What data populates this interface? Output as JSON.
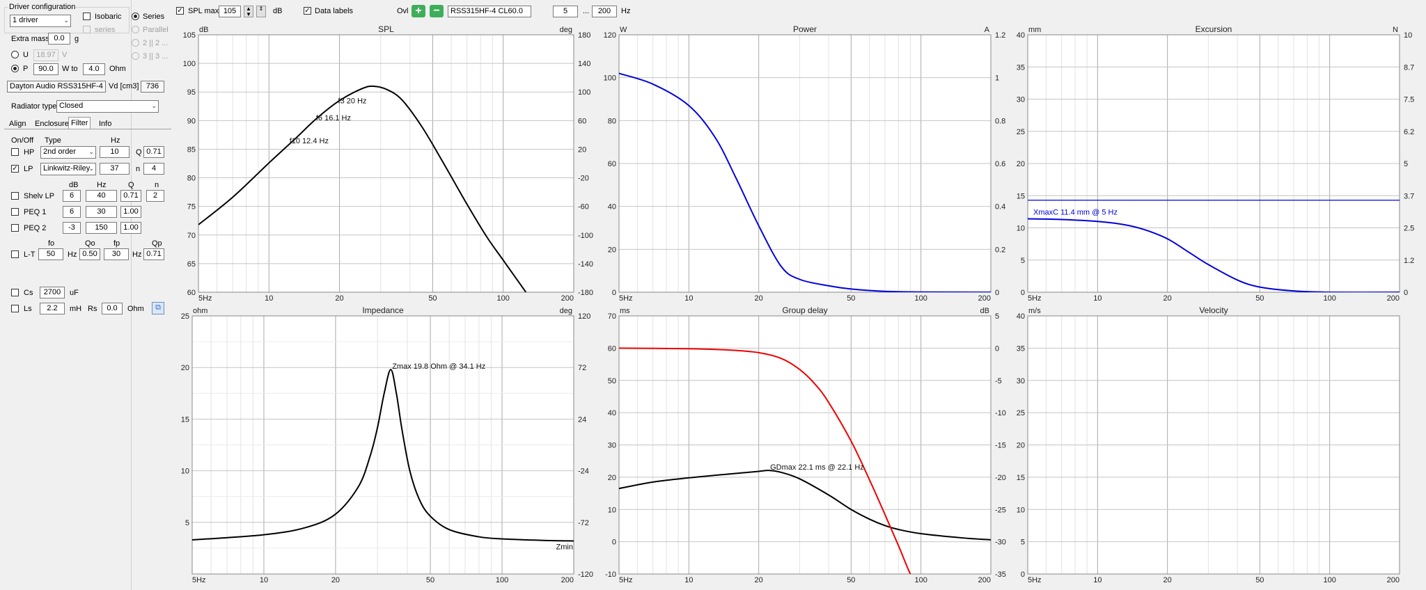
{
  "toolbar": {
    "spl_max_label": "SPL max",
    "spl_max_value": "105",
    "spl_max_unit": "dB",
    "data_labels_label": "Data labels",
    "ovl_label": "Ovl",
    "overlay_name": "RSS315HF-4 CL60.0",
    "freq_min": "5",
    "freq_sep": "...",
    "freq_max": "200",
    "freq_unit": "Hz"
  },
  "left": {
    "group_title": "Driver configuration",
    "driver_count": "1 driver",
    "isobaric": "Isobaric",
    "series_sub": "series",
    "series": "Series",
    "parallel": "Parallel",
    "opt_2": "2 || 2 ...",
    "opt_3": "3 || 3 ...",
    "extra_mass_label": "Extra mass",
    "extra_mass_value": "0.0",
    "extra_mass_unit": "g",
    "u_label": "U",
    "u_value": "18.97",
    "u_unit": "V",
    "p_label": "P",
    "p_value": "90.0",
    "p_unit": "W to",
    "ohm_value": "4.0",
    "ohm_unit": "Ohm",
    "driver_name": "Dayton Audio RSS315HF-4",
    "vd_label": "Vd [cm3]",
    "vd_value": "736",
    "radiator_label": "Radiator type",
    "radiator_value": "Closed",
    "tabs": [
      "Align",
      "Enclosure",
      "Filter",
      "Info"
    ],
    "col_onoff": "On/Off",
    "col_type": "Type",
    "col_hz": "Hz",
    "hp_label": "HP",
    "hp_type": "2nd order",
    "hp_hz": "10",
    "hp_q_label": "Q",
    "hp_q": "0.71",
    "lp_label": "LP",
    "lp_type": "Linkwitz-Riley",
    "lp_hz": "37",
    "lp_n_label": "n",
    "lp_n": "4",
    "peq_col_db": "dB",
    "peq_col_hz": "Hz",
    "peq_col_q": "Q",
    "peq_col_n": "n",
    "shelv_label": "Shelv LP",
    "shelv_db": "6",
    "shelv_hz": "40",
    "shelv_q": "0.71",
    "shelv_n": "2",
    "peq1_label": "PEQ 1",
    "peq1_db": "6",
    "peq1_hz": "30",
    "peq1_q": "1.00",
    "peq2_label": "PEQ 2",
    "peq2_db": "-3",
    "peq2_hz": "150",
    "peq2_q": "1.00",
    "lt_col_fo": "fo",
    "lt_col_qo": "Qo",
    "lt_col_fp": "fp",
    "lt_col_qp": "Qp",
    "lt_label": "L-T",
    "lt_fo": "50",
    "lt_fo_unit": "Hz",
    "lt_qo": "0.50",
    "lt_fp": "30",
    "lt_fp_unit": "Hz",
    "lt_qp": "0.71",
    "cs_label": "Cs",
    "cs_value": "2700",
    "cs_unit": "uF",
    "ls_label": "Ls",
    "ls_value": "2.2",
    "ls_unit": "mH",
    "rs_label": "Rs",
    "rs_value": "0.0",
    "rs_unit": "Ohm"
  },
  "colors": {
    "spl": "#000000",
    "power": "#0000dd",
    "excursion": "#0000dd",
    "impedance": "#000000",
    "group_delay": "#000000",
    "phase": "#ee0000",
    "grid": "#c0c0c0",
    "accent_green": "#3fae5a"
  },
  "chart_data": [
    {
      "id": "spl",
      "type": "line",
      "title": "SPL",
      "ylabel": "dB",
      "y2label": "deg",
      "x_ticks": [
        "5Hz",
        "10",
        "20",
        "50",
        "100",
        "200"
      ],
      "xlim": [
        5,
        200
      ],
      "ylim": [
        60,
        105
      ],
      "y2lim": [
        -180,
        180
      ],
      "y_ticks": [
        60,
        65,
        70,
        75,
        80,
        85,
        90,
        95,
        100,
        105
      ],
      "y2_ticks": [
        -180,
        -140,
        -100,
        -60,
        -20,
        20,
        60,
        100,
        140,
        180
      ],
      "series": [
        {
          "color": "#000000",
          "x": [
            5,
            7,
            10,
            13,
            16,
            20,
            25,
            28,
            32,
            37,
            45,
            55,
            70,
            85,
            100,
            125
          ],
          "y": [
            71.8,
            76.6,
            82.6,
            86.9,
            90.4,
            93.5,
            95.6,
            96.0,
            95.4,
            93.6,
            88.9,
            82.9,
            75.4,
            69.7,
            65.6,
            60
          ]
        }
      ],
      "annotations": [
        {
          "text": "f3 20 Hz",
          "x": 20,
          "y": 93.5
        },
        {
          "text": "f6 16.1 Hz",
          "x": 16.1,
          "y": 90.5
        },
        {
          "text": "f10 12.4 Hz",
          "x": 12.4,
          "y": 86.5
        }
      ]
    },
    {
      "id": "power",
      "type": "line",
      "title": "Power",
      "ylabel": "W",
      "y2label": "A",
      "x_ticks": [
        "5Hz",
        "10",
        "20",
        "50",
        "100",
        "200"
      ],
      "xlim": [
        5,
        200
      ],
      "ylim": [
        0,
        120
      ],
      "y2lim": [
        0,
        1.2
      ],
      "y_ticks": [
        0,
        20,
        40,
        60,
        80,
        100,
        120
      ],
      "y2_ticks": [
        "0",
        "0.2",
        "0.4",
        "0.6",
        "0.8",
        "1",
        "1.2"
      ],
      "series": [
        {
          "color": "#0000dd",
          "x": [
            5,
            7,
            10,
            13,
            16,
            20,
            25,
            30,
            40,
            50,
            70,
            100,
            200
          ],
          "y": [
            102,
            97,
            87,
            72,
            53,
            31,
            12,
            6,
            3,
            1.5,
            0.4,
            0.1,
            0
          ]
        }
      ]
    },
    {
      "id": "excursion",
      "type": "line",
      "title": "Excursion",
      "ylabel": "mm",
      "y2label": "N",
      "x_ticks": [
        "5Hz",
        "10",
        "20",
        "50",
        "100",
        "200"
      ],
      "xlim": [
        5,
        200
      ],
      "ylim": [
        0,
        40
      ],
      "y_ticks": [
        0,
        5,
        10,
        15,
        20,
        25,
        30,
        35,
        40
      ],
      "y2_ticks": [
        "0",
        "1.2",
        "2.5",
        "3.7",
        "5",
        "6.2",
        "7.5",
        "8.7",
        "10"
      ],
      "xmax_line": 14.3,
      "series": [
        {
          "color": "#0000dd",
          "x": [
            5,
            7,
            10,
            13,
            16,
            20,
            25,
            30,
            40,
            50,
            70,
            100,
            200
          ],
          "y": [
            11.4,
            11.3,
            11.0,
            10.5,
            9.7,
            8.3,
            6.1,
            4.3,
            1.9,
            0.8,
            0.2,
            0,
            0
          ]
        }
      ],
      "annotations": [
        {
          "text": "XmaxC 11.4 mm  @ 5 Hz",
          "x": 5,
          "y": 11.4
        }
      ]
    },
    {
      "id": "impedance",
      "type": "line",
      "title": "Impedance",
      "ylabel": "ohm",
      "y2label": "deg",
      "x_ticks": [
        "5Hz",
        "10",
        "20",
        "50",
        "100",
        "200"
      ],
      "xlim": [
        5,
        200
      ],
      "ylim": [
        0,
        25
      ],
      "y2lim": [
        -120,
        120
      ],
      "y_ticks": [
        5,
        10,
        15,
        20,
        25
      ],
      "y2_ticks": [
        -120,
        -72,
        -24,
        24,
        72,
        120
      ],
      "series": [
        {
          "color": "#000000",
          "x": [
            5,
            10,
            15,
            20,
            25,
            28,
            30,
            32,
            34.1,
            36,
            38,
            41,
            45,
            50,
            60,
            80,
            100,
            150,
            200
          ],
          "y": [
            3.3,
            3.8,
            4.5,
            5.8,
            8.5,
            11.5,
            14.2,
            17.5,
            19.8,
            17.5,
            14.0,
            10.0,
            7.2,
            5.6,
            4.3,
            3.6,
            3.4,
            3.25,
            3.2
          ]
        }
      ],
      "annotations": [
        {
          "text": "Zmax 19.8 Ohm @ 34.1 Hz",
          "x": 34.1,
          "y": 19.8
        },
        {
          "text": "Zmin",
          "x": 195,
          "y": 3.2
        }
      ]
    },
    {
      "id": "group_delay",
      "type": "line",
      "title": "Group delay",
      "ylabel": "ms",
      "y2label": "dB",
      "x_ticks": [
        "5Hz",
        "10",
        "20",
        "50",
        "100",
        "200"
      ],
      "xlim": [
        5,
        200
      ],
      "ylim": [
        -10,
        70
      ],
      "y2lim": [
        -35,
        5
      ],
      "y_ticks": [
        -10,
        0,
        10,
        20,
        30,
        40,
        50,
        60,
        70
      ],
      "y2_ticks": [
        -35,
        -30,
        -25,
        -20,
        -15,
        -10,
        -5,
        0,
        5
      ],
      "series": [
        {
          "color": "#000000",
          "axis": "left",
          "x": [
            5,
            7,
            10,
            15,
            20,
            22.1,
            25,
            30,
            40,
            50,
            60,
            70,
            80,
            100,
            150,
            200
          ],
          "y": [
            16.5,
            18.5,
            19.8,
            21.0,
            21.8,
            22.1,
            21.5,
            19.5,
            14.5,
            10.0,
            7.0,
            5.0,
            3.8,
            2.5,
            1.2,
            0.6
          ]
        },
        {
          "color": "#ee0000",
          "axis": "right",
          "x": [
            5,
            10,
            15,
            20,
            25,
            30,
            35,
            40,
            50,
            60,
            70,
            80,
            90,
            100
          ],
          "y": [
            0,
            -0.1,
            -0.3,
            -0.7,
            -1.6,
            -3.3,
            -5.6,
            -8.4,
            -14.4,
            -20.4,
            -25.8,
            -30.6,
            -35,
            -38
          ]
        }
      ],
      "annotations": [
        {
          "text": "GDmax 22.1 ms  @ 22.1 Hz",
          "x": 22.1,
          "y": 22.1
        }
      ]
    },
    {
      "id": "velocity",
      "type": "line",
      "title": "Velocity",
      "ylabel": "m/s",
      "x_ticks": [
        "5Hz",
        "10",
        "20",
        "50",
        "100",
        "200"
      ],
      "xlim": [
        5,
        200
      ],
      "ylim": [
        0,
        40
      ],
      "y_ticks": [
        0,
        5,
        10,
        15,
        20,
        25,
        30,
        35,
        40
      ],
      "series": []
    }
  ]
}
